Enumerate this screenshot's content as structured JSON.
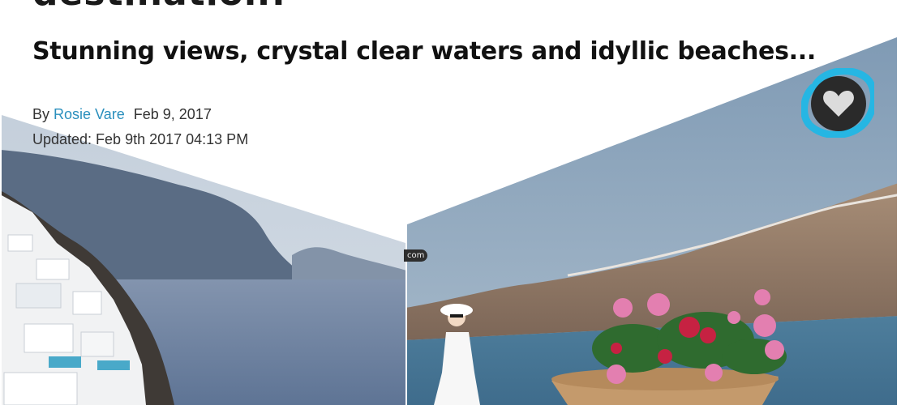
{
  "article": {
    "title_partial": "destination!",
    "subtitle": "Stunning views, crystal clear waters and idyllic beaches...",
    "byline_prefix": "By",
    "author": "Rosie Vare",
    "date": "Feb 9, 2017",
    "updated": "Updated: Feb 9th 2017 04:13 PM"
  },
  "gallery": {
    "watermark": "com",
    "favorite_icon": "heart-icon"
  },
  "colors": {
    "author_link": "#2a8fbd",
    "heart_ring": "#26b6e3",
    "heart_bg": "#2a2a2a"
  }
}
